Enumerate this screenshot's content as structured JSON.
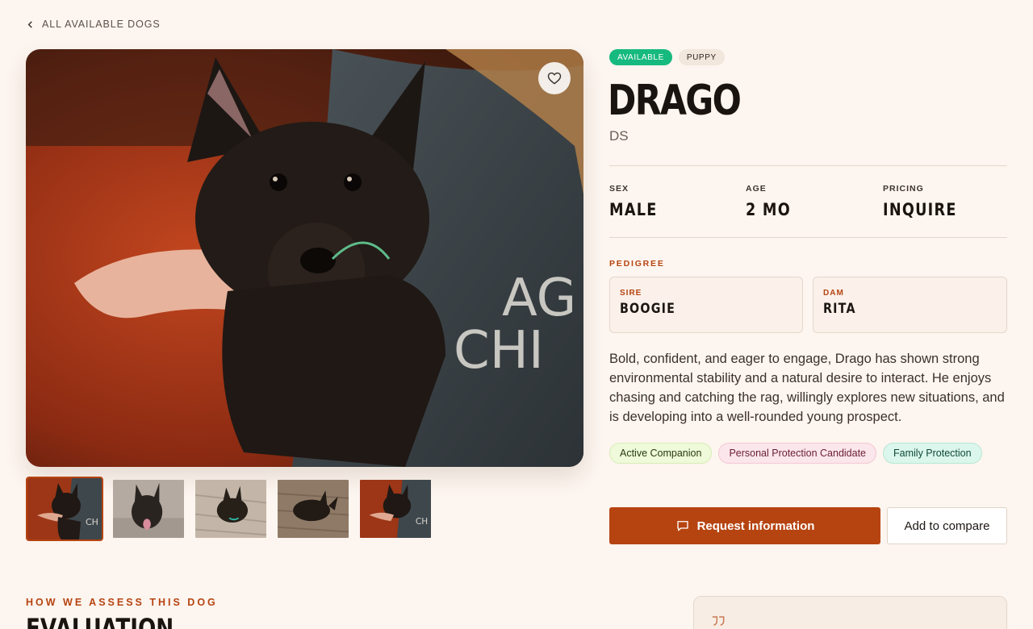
{
  "nav": {
    "back_label": "ALL AVAILABLE DOGS"
  },
  "gallery": {
    "selected_index": 0,
    "thumbnail_count": 5
  },
  "dog": {
    "status_badge": "AVAILABLE",
    "stage_badge": "PUPPY",
    "name": "DRAGO",
    "code": "DS",
    "stats": [
      {
        "label": "SEX",
        "value": "MALE"
      },
      {
        "label": "AGE",
        "value": "2 MO"
      },
      {
        "label": "PRICING",
        "value": "INQUIRE"
      }
    ],
    "pedigree": {
      "title": "PEDIGREE",
      "sire_label": "SIRE",
      "sire": "BOOGIE",
      "dam_label": "DAM",
      "dam": "RITA"
    },
    "description": "Bold, confident, and eager to engage, Drago has shown strong environmental stability and a natural desire to interact. He enjoys chasing and catching the rag, willingly explores new situations, and is developing into a well-rounded young prospect.",
    "tags": [
      "Active Companion",
      "Personal Protection Candidate",
      "Family Protection"
    ]
  },
  "actions": {
    "request_label": "Request information",
    "compare_label": "Add to compare"
  },
  "evaluation": {
    "eyebrow": "HOW WE ASSESS THIS DOG",
    "title": "EVALUATION"
  },
  "colors": {
    "accent": "#b64411",
    "available": "#16b97e",
    "background": "#fdf5ef"
  }
}
